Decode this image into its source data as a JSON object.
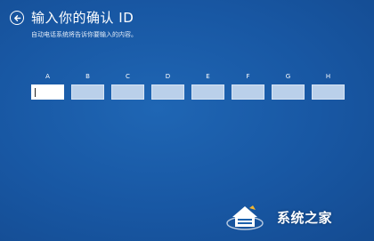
{
  "header": {
    "title": "输入你的确认 ID",
    "subtitle": "自动电话系统将告诉你要输入的内容。"
  },
  "fields": [
    {
      "label": "A",
      "value": ""
    },
    {
      "label": "B",
      "value": ""
    },
    {
      "label": "C",
      "value": ""
    },
    {
      "label": "D",
      "value": ""
    },
    {
      "label": "E",
      "value": ""
    },
    {
      "label": "F",
      "value": ""
    },
    {
      "label": "G",
      "value": ""
    },
    {
      "label": "H",
      "value": ""
    }
  ],
  "watermark": {
    "text": "系统之家",
    "icon": "xitong-house-logo-icon"
  },
  "colors": {
    "background": "#1857a3",
    "field_fill": "#bad0ea",
    "active_field_fill": "#ffffff",
    "text": "#ffffff"
  }
}
